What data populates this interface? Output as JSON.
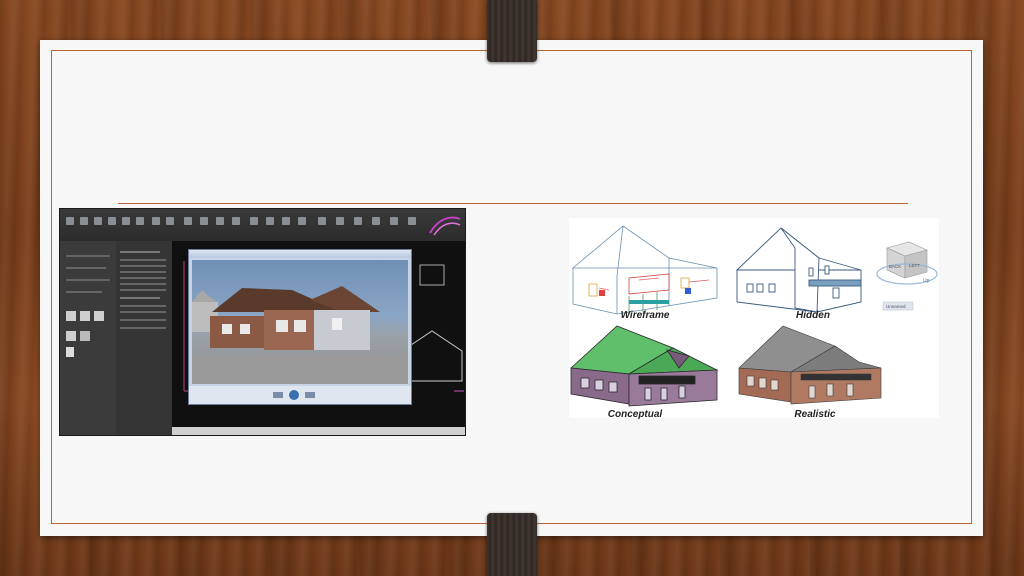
{
  "slide": {
    "title": ""
  },
  "cad_screenshot": {
    "alt_semantic": "autocad-rendered-house-screenshot"
  },
  "visual_styles": {
    "labels": {
      "wireframe": "Wireframe",
      "hidden": "Hidden",
      "conceptual": "Conceptual",
      "realistic": "Realistic"
    },
    "viewcube": {
      "back": "BACK",
      "left": "LEFT",
      "up": "Up",
      "unnamed": "Unnamed"
    }
  },
  "colors": {
    "frame_line": "#b8643a",
    "wood": "#7a3f1b",
    "conceptual_roof": "#5fbf6a",
    "conceptual_wall": "#8a6a8a",
    "realistic_roof": "#8f8f8f",
    "realistic_wall": "#a36a55"
  }
}
